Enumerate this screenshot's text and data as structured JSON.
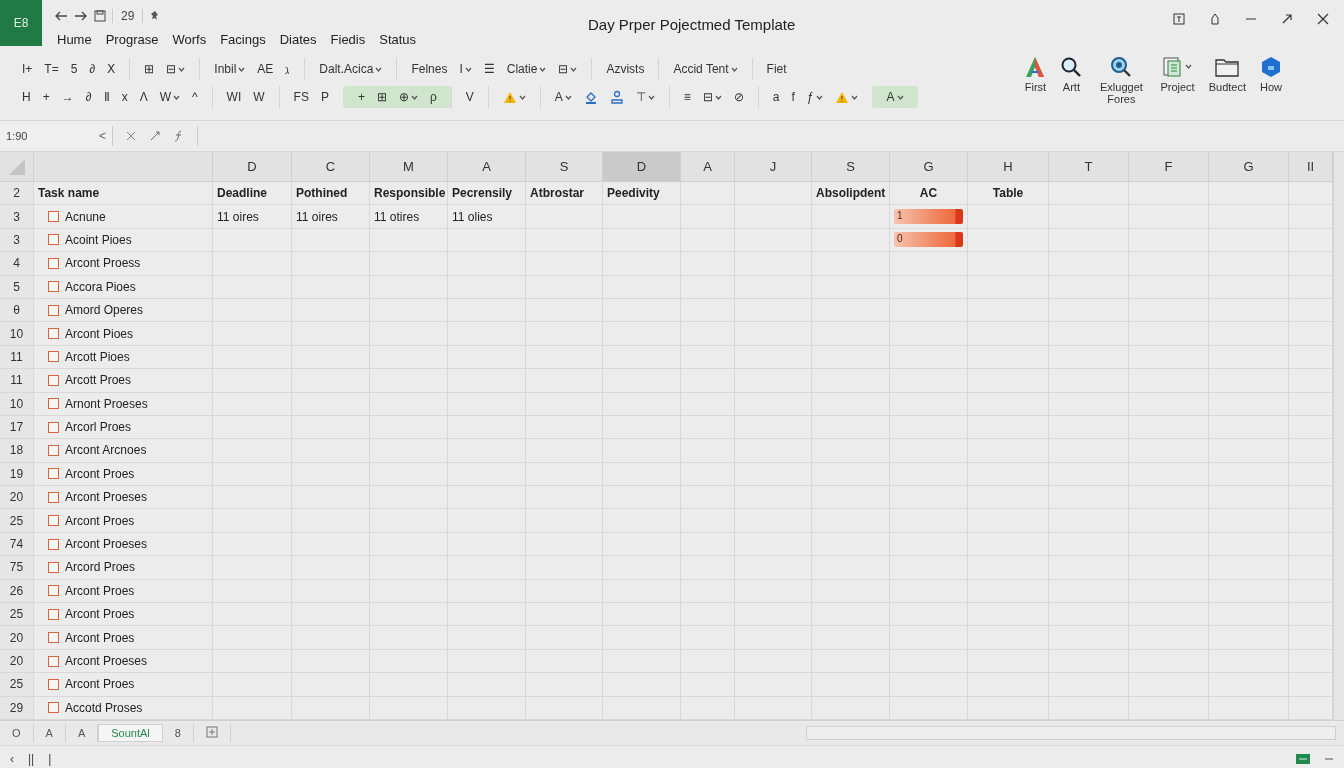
{
  "app": {
    "badge": "E8",
    "quick_label": "29"
  },
  "menu": [
    {
      "label": "Hume",
      "selected": false
    },
    {
      "label": "Prograse",
      "selected": false
    },
    {
      "label": "Worfs",
      "selected": false
    },
    {
      "label": "Facings",
      "selected": false
    },
    {
      "label": "Diates",
      "selected": false
    },
    {
      "label": "Fiedis",
      "selected": false
    },
    {
      "label": "Status",
      "selected": false
    }
  ],
  "window": {
    "title": "Day Prper Pojectmed Template"
  },
  "ribbon": {
    "top_row": [
      {
        "on": false,
        "items": [
          {
            "text": "I+",
            "dropdown": false
          },
          {
            "text": "T=",
            "dropdown": false
          },
          {
            "text": "5",
            "dropdown": false
          },
          {
            "text": "∂",
            "dropdown": false
          },
          {
            "text": "Ⅹ",
            "dropdown": false
          }
        ]
      },
      {
        "on": false,
        "items": [
          {
            "text": "⊞",
            "dropdown": false
          },
          {
            "text": "⊟",
            "dropdown": true
          }
        ]
      },
      {
        "on": false,
        "items": [
          {
            "text": "Inbil",
            "dropdown": true
          },
          {
            "text": "AE",
            "dropdown": false
          },
          {
            "text": "ℷ",
            "dropdown": false
          }
        ]
      },
      {
        "on": false,
        "items": [
          {
            "text": "Dalt.Acica",
            "dropdown": true
          }
        ]
      },
      {
        "on": false,
        "items": [
          {
            "text": "Felnes",
            "dropdown": false
          },
          {
            "text": "I",
            "dropdown": true
          },
          {
            "text": "☰",
            "dropdown": false
          },
          {
            "text": "Clatie",
            "dropdown": true
          },
          {
            "text": "⊟",
            "dropdown": true
          }
        ]
      },
      {
        "on": false,
        "items": [
          {
            "text": "Azvists",
            "dropdown": false
          }
        ]
      },
      {
        "on": false,
        "items": [
          {
            "text": "Accid Tent",
            "dropdown": true
          }
        ]
      },
      {
        "on": false,
        "items": [
          {
            "text": "Fiet",
            "dropdown": false
          }
        ]
      }
    ],
    "bottom_row": [
      {
        "on": false,
        "items": [
          {
            "text": "H",
            "dropdown": false
          },
          {
            "text": "+",
            "dropdown": false
          },
          {
            "text": "→",
            "dropdown": false
          },
          {
            "text": "∂",
            "dropdown": false
          },
          {
            "text": "Ⅱ",
            "dropdown": false
          },
          {
            "text": "x",
            "dropdown": false
          },
          {
            "text": "Λ",
            "dropdown": false
          },
          {
            "text": "W",
            "dropdown": true
          },
          {
            "text": "^",
            "dropdown": false
          }
        ]
      },
      {
        "on": false,
        "items": [
          {
            "text": "WI",
            "dropdown": false
          },
          {
            "text": "W",
            "dropdown": false
          }
        ]
      },
      {
        "on": false,
        "items": [
          {
            "text": "FS",
            "dropdown": false
          },
          {
            "text": "P",
            "dropdown": false
          }
        ]
      },
      {
        "on": true,
        "items": [
          {
            "text": "+",
            "dropdown": false
          },
          {
            "text": "⊞",
            "dropdown": false
          },
          {
            "text": "⊕",
            "dropdown": true
          },
          {
            "text": "ρ",
            "dropdown": false
          }
        ]
      },
      {
        "on": false,
        "items": [
          {
            "text": "V",
            "dropdown": false
          }
        ]
      },
      {
        "on": false,
        "items": [
          {
            "kind": "warning",
            "dropdown": true
          }
        ]
      },
      {
        "on": false,
        "items": [
          {
            "text": "A",
            "dropdown": true
          },
          {
            "kind": "fill",
            "dropdown": false
          },
          {
            "kind": "person",
            "dropdown": false
          },
          {
            "text": "⊤",
            "dropdown": true
          }
        ]
      },
      {
        "on": false,
        "items": [
          {
            "text": "≡",
            "dropdown": false
          },
          {
            "text": "⊟",
            "dropdown": true
          },
          {
            "text": "⊘",
            "dropdown": false
          }
        ]
      },
      {
        "on": false,
        "items": [
          {
            "text": "a",
            "dropdown": false
          },
          {
            "text": "f",
            "dropdown": false
          },
          {
            "text": "ƒ",
            "dropdown": true
          },
          {
            "kind": "warning",
            "dropdown": true
          }
        ]
      },
      {
        "on": true,
        "items": [
          {
            "text": "A",
            "dropdown": true
          }
        ]
      }
    ],
    "buttons": [
      {
        "label": "First",
        "kind": "letter"
      },
      {
        "label": "Artt",
        "kind": "search"
      },
      {
        "label": "Exlugget Fores",
        "kind": "zoom"
      },
      {
        "label": "Project",
        "kind": "sheet"
      },
      {
        "label": "Budtect",
        "kind": "folder"
      },
      {
        "label": "How",
        "kind": "hexagon"
      }
    ]
  },
  "formula_bar": {
    "name_box": "1:90",
    "nav": "<"
  },
  "grid": {
    "corner_row": "2",
    "task_header": "Task name",
    "columns": [
      {
        "letter": "D",
        "label": "Deadline",
        "selected": false
      },
      {
        "letter": "C",
        "label": "Pothined",
        "selected": false
      },
      {
        "letter": "M",
        "label": "Responsible",
        "selected": false
      },
      {
        "letter": "A",
        "label": "Pecrensily",
        "selected": false
      },
      {
        "letter": "S",
        "label": "Atbrostar",
        "selected": false
      },
      {
        "letter": "D",
        "label": "Peedivity",
        "selected": true
      },
      {
        "letter": "A",
        "selected": false
      },
      {
        "letter": "J",
        "selected": false
      },
      {
        "letter": "S",
        "label": "Absolipdent",
        "selected": false
      },
      {
        "letter": "G",
        "label": "AC",
        "kind": "bar",
        "selected": false
      },
      {
        "letter": "H",
        "label": "Table",
        "selected": false
      },
      {
        "letter": "T",
        "selected": false
      },
      {
        "letter": "F",
        "selected": false
      },
      {
        "letter": "G",
        "selected": false
      },
      {
        "letter": "II",
        "selected": false
      }
    ],
    "rows": [
      {
        "number": "3",
        "task": "Acnune",
        "checked": false,
        "values": [
          "11 oires",
          "11 oires",
          "11 otires",
          "11 olies"
        ],
        "bar": {
          "label": "1",
          "level": 1
        }
      },
      {
        "number": "3",
        "task": "Acoint Pioes",
        "checked": false,
        "bar": {
          "label": "0",
          "level": 1
        }
      },
      {
        "number": "4",
        "task": "Arcont Proess",
        "checked": false
      },
      {
        "number": "5",
        "task": "Accora Pioes",
        "checked": false
      },
      {
        "number": "θ",
        "task": "Amord Operes",
        "checked": false
      },
      {
        "number": "10",
        "task": "Arcont Pioes",
        "checked": false
      },
      {
        "number": "11",
        "task": "Arcott Pioes",
        "checked": false
      },
      {
        "number": "11",
        "task": "Arcott Proes",
        "checked": false
      },
      {
        "number": "10",
        "task": "Arnont Proeses",
        "checked": false
      },
      {
        "number": "17",
        "task": "Arcorl Proes",
        "checked": false
      },
      {
        "number": "18",
        "task": "Arcont Arcnoes",
        "checked": false
      },
      {
        "number": "19",
        "task": "Arcont Proes",
        "checked": false
      },
      {
        "number": "20",
        "task": "Arcont Proeses",
        "checked": false
      },
      {
        "number": "25",
        "task": "Arcont Proes",
        "checked": false
      },
      {
        "number": "74",
        "task": "Arcont Proeses",
        "checked": false
      },
      {
        "number": "75",
        "task": "Arcord Proes",
        "checked": false
      },
      {
        "number": "26",
        "task": "Arcont Proes",
        "checked": false
      },
      {
        "number": "25",
        "task": "Arcont Proes",
        "checked": false
      },
      {
        "number": "20",
        "task": "Arcont Proes",
        "checked": false
      },
      {
        "number": "20",
        "task": "Arcont Proeses",
        "checked": false
      },
      {
        "number": "25",
        "task": "Arcont Proes",
        "checked": false
      },
      {
        "number": "29",
        "task": "Accotd Proses",
        "checked": false
      }
    ]
  },
  "sheet_tabs": [
    {
      "label": "O",
      "selected": false
    },
    {
      "label": "A",
      "selected": false
    },
    {
      "label": "A",
      "selected": false
    },
    {
      "label": "SountAl",
      "selected": true
    },
    {
      "label": "8",
      "selected": false
    }
  ],
  "status_bar": {
    "items": [
      "‹",
      "||",
      "|"
    ]
  }
}
